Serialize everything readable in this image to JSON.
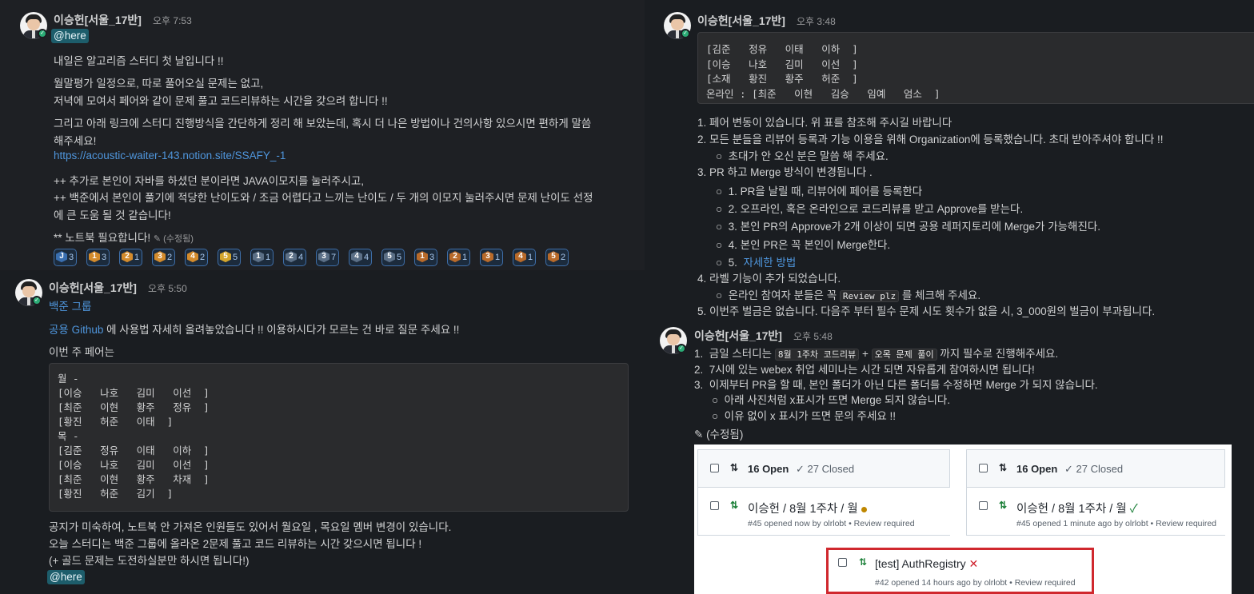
{
  "p1": {
    "user": "이승헌[서울_17반]",
    "time": "오후 7:53",
    "mention": "@here",
    "lines": [
      "내일은 알고리즘 스터디 첫 날입니다 !!",
      "월말평가 일정으로, 따로 풀어오실 문제는 없고,",
      "저녁에 모여서 페어와 같이 문제 풀고 코드리뷰하는 시간을 갖으려 합니다 !!",
      "그리고 아래 링크에 스터디 진행방식을 간단하게 정리 해 보았는데, 혹시 더 나은 방법이나 건의사항 있으시면 편하게 말씀",
      "해주세요!",
      "https://acoustic-waiter-143.notion.site/SSAFY_-1",
      "++ 추가로 본인이 자바를 하셨던 분이라면 JAVA이모지를 눌러주시고,",
      "++ 백준에서 본인이 풀기에 적당한 난이도와 / 조금 어렵다고 느끼는 난이도 / 두 개의 이모지 눌러주시면 문제 난이도 선정",
      "에 큰 도움 될 것 같습니다!",
      "** 노트북 필요합니다!"
    ],
    "edited": "(수정됨)",
    "reactions": [
      {
        "label": "J",
        "count": "3",
        "color": "#3a6fb0"
      },
      {
        "label": "1",
        "count": "3",
        "color": "#d38b2c"
      },
      {
        "label": "2",
        "count": "1",
        "color": "#d38b2c"
      },
      {
        "label": "3",
        "count": "2",
        "color": "#d38b2c"
      },
      {
        "label": "4",
        "count": "2",
        "color": "#d38b2c"
      },
      {
        "label": "5",
        "count": "5",
        "color": "#d3a52c"
      },
      {
        "label": "1",
        "count": "1",
        "color": "#5b6f86"
      },
      {
        "label": "2",
        "count": "4",
        "color": "#5b6f86"
      },
      {
        "label": "3",
        "count": "7",
        "color": "#5b6f86"
      },
      {
        "label": "4",
        "count": "4",
        "color": "#5b6f86"
      },
      {
        "label": "5",
        "count": "5",
        "color": "#5b6f86"
      },
      {
        "label": "1",
        "count": "3",
        "color": "#b86a2a"
      },
      {
        "label": "2",
        "count": "1",
        "color": "#b86a2a"
      },
      {
        "label": "3",
        "count": "1",
        "color": "#b86a2a"
      },
      {
        "label": "4",
        "count": "1",
        "color": "#b86a2a"
      },
      {
        "label": "5",
        "count": "2",
        "color": "#b86a2a"
      }
    ]
  },
  "p2": {
    "user": "이승헌[서울_17반]",
    "time": "오후 5:50",
    "group": "백준 그룹",
    "github_link": "공용 Github",
    "line1_rest": " 에 사용법 자세히 올려놓았습니다 !! 이용하시다가 모르는 건 바로 질문 주세요 !!",
    "pair_title": "이번 주 페어는",
    "code": [
      "월 -",
      "[이승   나호   김미   이선  ]",
      "[최준   이현   황주   정유  ]",
      "[황진   허준   이태  ]",
      "목 -",
      "[김준   정유   이태   이하  ]",
      "[이승   나호   김미   이선  ]",
      "[최준   이현   황주   차재  ]",
      "[황진   허준   김기  ]"
    ],
    "after": [
      "공지가 미숙하여, 노트북 안 가져온 인원들도 있어서 월요일 , 목요일 멤버 변경이 있습니다.",
      "오늘 스터디는 백준 그룹에 올라온 2문제 풀고 코드 리뷰하는 시간 갖으시면 됩니다 !",
      "(+ 골드 문제는 도전하실분만 하시면 됩니다!)"
    ],
    "mention": "@here"
  },
  "p3": {
    "user": "이승헌[서울_17반]",
    "time": "오후 3:48",
    "code": [
      "[김준   정유   이태   이하  ]",
      "[이승   나호   김미   이선  ]",
      "[소재   황진   황주   허준  ]",
      "온라인 : [최준   이현   김승   임예   엄소  ]"
    ],
    "items": [
      {
        "n": "1.",
        "text": "페어 변동이 있습니다. 위 표를 참조해 주시길 바랍니다"
      },
      {
        "n": "2.",
        "text": "모든 분들을 리뷰어 등록과 기능 이용을 위해 Organization에 등록했습니다. 초대 받아주셔야 합니다 !!"
      },
      {
        "sub": "초대가 안 오신 분은 말씀 해 주세요."
      },
      {
        "n": "3.",
        "text": "PR 하고 Merge 방식이 변경됩니다 ."
      },
      {
        "sub": "1.  PR을 날릴 때, 리뷰어에 페어를 등록한다"
      },
      {
        "sub": "2.  오프라인, 혹은 온라인으로 코드리뷰를 받고 Approve를 받는다."
      },
      {
        "sub": "3.  본인 PR의 Approve가 2개 이상이 되면 공용 레퍼지토리에 Merge가 가능해진다."
      },
      {
        "sub": "4.  본인 PR은 꼭 본인이 Merge한다."
      },
      {
        "sub_num": "5.",
        "sub_link": "자세한 방법"
      },
      {
        "n": "4.",
        "text": "라벨 기능이 추가 되었습니다."
      },
      {
        "sub_pre": "온라인 참여자 분들은 꼭",
        "sub_code": "Review plz",
        "sub_post": "를 체크해 주세요."
      },
      {
        "n": "5.",
        "text": "이번주 벌금은 없습니다. 다음주 부터 필수 문제 시도 횟수가 없을 시, 3_000원의 벌금이 부과됩니다."
      }
    ]
  },
  "p4": {
    "user": "이승헌[서울_17반]",
    "time": "오후 5:48",
    "l1_pre": "금일 스터디는",
    "l1_code1": "8월 1주차 코드리뷰",
    "l1_plus": "+",
    "l1_code2": "오목 문제 풀이",
    "l1_post": "까지 필수로 진행해주세요.",
    "l2": "7시에 있는 webex 취업 세미나는 시간 되면 자유롭게 참여하시면 됩니다!",
    "l3": "이제부터 PR을 할 때, 본인 폴더가 아닌 다른 폴더를 수정하면 Merge 가 되지 않습니다.",
    "s1": "아래 사진처럼 x표시가 뜨면 Merge 되지 않습니다.",
    "s2": "이유 없이 x 표시가 뜨면 문의 주세요 !!",
    "n1": "1.",
    "n2": "2.",
    "n3": "3.",
    "edited": "(수정됨)"
  },
  "github": {
    "open": "16 Open",
    "closed": "27 Closed",
    "left_pr_title": "이승헌 / 8월 1주차 / 월",
    "left_pr_meta": "#45 opened now by olrlobt • Review required",
    "right_pr_title": "이승헌 / 8월 1주차 / 월",
    "right_pr_meta": "#45 opened 1 minute ago by olrlobt • Review required",
    "box_title": "[test] AuthRegistry",
    "box_meta": "#42 opened 14 hours ago by olrlobt • Review required",
    "status_pending_color": "#bf8700",
    "status_ok_color": "#1a7f37",
    "status_fail_color": "#cf222e"
  }
}
